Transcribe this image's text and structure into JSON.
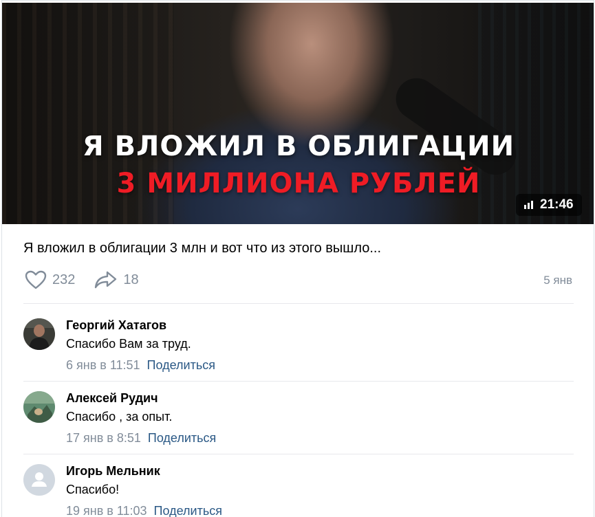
{
  "video": {
    "headline_line1": "Я ВЛОЖИЛ В ОБЛИГАЦИИ",
    "headline_line2": "3 МИЛЛИОНА РУБЛЕЙ",
    "duration": "21:46",
    "title": "Я вложил в облигации 3 млн и вот что из этого вышло...",
    "likes": "232",
    "shares": "18",
    "date": "5 янв"
  },
  "comments": [
    {
      "author": "Георгий Хатагов",
      "text": "Спасибо Вам за труд.",
      "time": "6 янв в 11:51",
      "share_label": "Поделиться"
    },
    {
      "author": "Алексей Рудич",
      "text": "Спасибо , за опыт.",
      "time": "17 янв в 8:51",
      "share_label": "Поделиться"
    },
    {
      "author": "Игорь Мельник",
      "text": "Спасибо!",
      "time": "19 янв в 11:03",
      "share_label": "Поделиться"
    }
  ],
  "colors": {
    "link": "#2a5885",
    "muted": "#818c99",
    "headline_red": "#ef1c25"
  }
}
